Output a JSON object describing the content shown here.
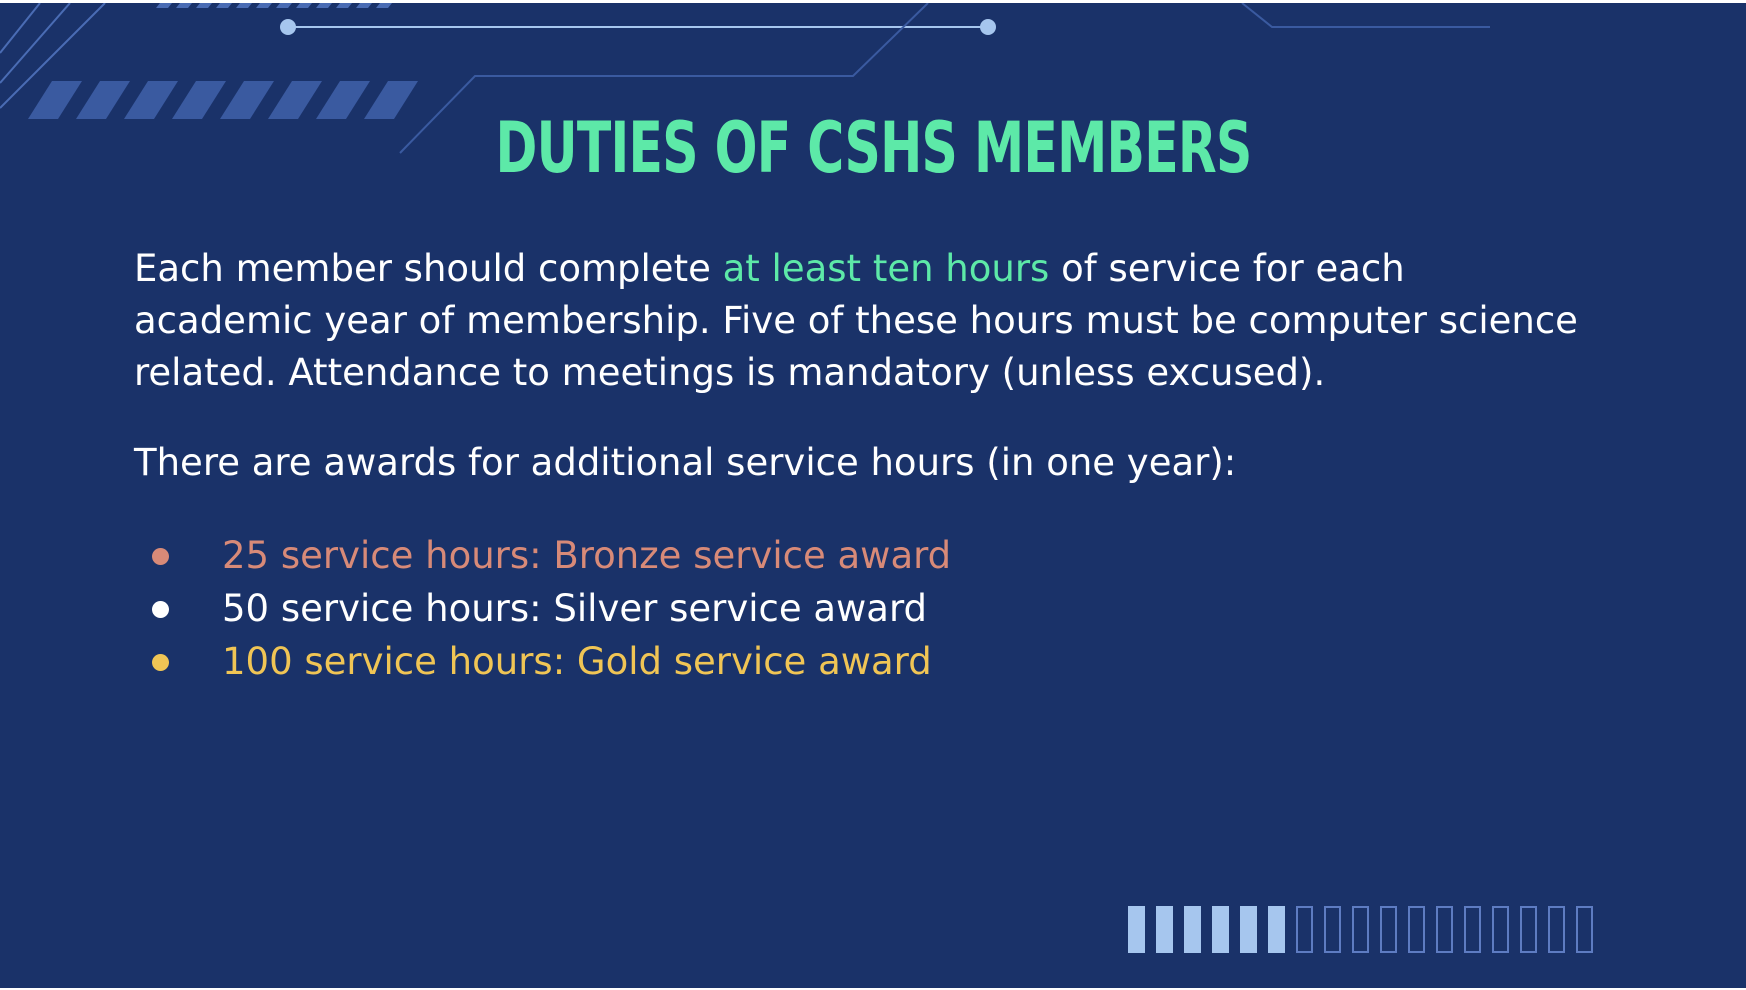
{
  "slide": {
    "title": "DUTIES OF CSHS MEMBERS",
    "paragraph1": {
      "before": "Each member should complete ",
      "highlight": "at least ten hours",
      "after": " of service for each academic year of membership. Five of these hours must be computer science related. Attendance to meetings is mandatory (unless excused)."
    },
    "paragraph2": "There are awards for additional service hours (in one year):",
    "awards": [
      {
        "label": "25 service hours: Bronze service award",
        "color": "#d88a78"
      },
      {
        "label": "50 service hours: Silver service award",
        "color": "#ffffff"
      },
      {
        "label": "100 service hours: Gold service award",
        "color": "#f0c555"
      }
    ],
    "progress": {
      "filled": 6,
      "total": 17
    }
  },
  "colors": {
    "background": "#1a3269",
    "accent": "#5de9a8",
    "text": "#ffffff",
    "decor": "#3a5aa0"
  }
}
